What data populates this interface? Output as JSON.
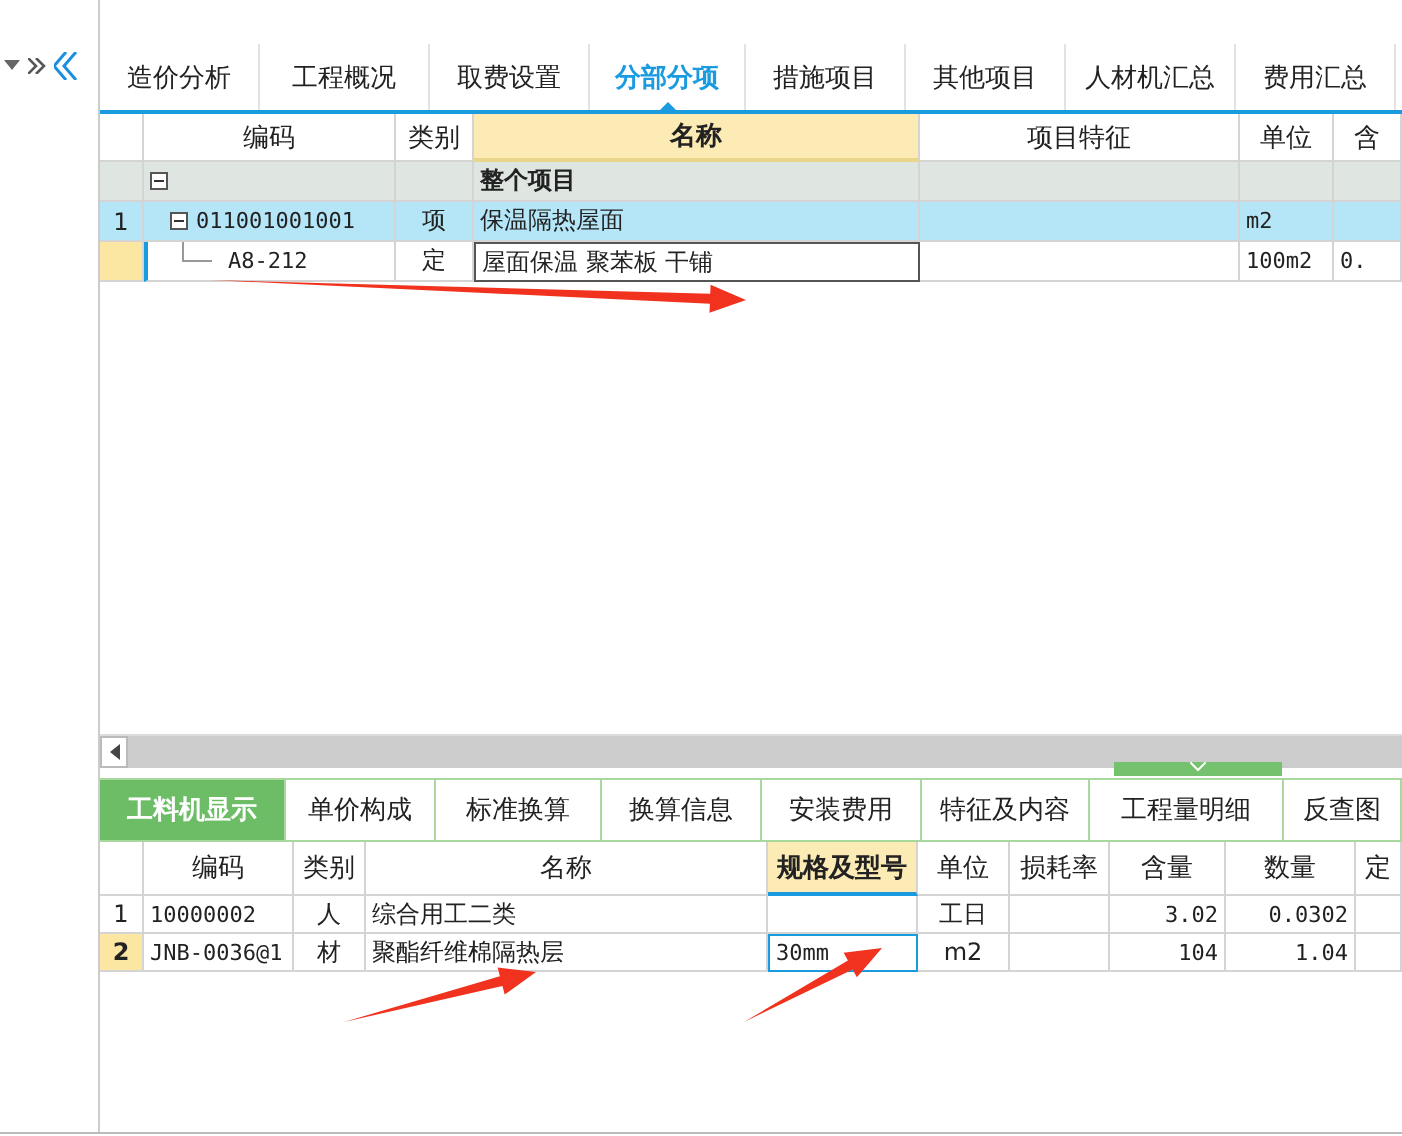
{
  "upper_tabs": [
    {
      "label": "造价分析",
      "selected": false
    },
    {
      "label": "工程概况",
      "selected": false
    },
    {
      "label": "取费设置",
      "selected": false
    },
    {
      "label": "分部分项",
      "selected": true
    },
    {
      "label": "措施项目",
      "selected": false
    },
    {
      "label": "其他项目",
      "selected": false
    },
    {
      "label": "人材机汇总",
      "selected": false
    },
    {
      "label": "费用汇总",
      "selected": false
    }
  ],
  "bill_table": {
    "columns": [
      {
        "active": false
      },
      {
        "label": "编码",
        "active": false
      },
      {
        "label": "类别",
        "active": false
      },
      {
        "label": "名称",
        "active": true
      },
      {
        "label": "项目特征",
        "active": false
      },
      {
        "label": "单位",
        "active": false
      },
      {
        "label": "含",
        "active": false
      }
    ],
    "rows": [
      {
        "kind": "group",
        "expanded": true,
        "selected": false,
        "editing": false,
        "cells": [
          "",
          "",
          "",
          "整个项目",
          "",
          "",
          ""
        ]
      },
      {
        "kind": "item",
        "expanded": true,
        "selected": true,
        "editing": false,
        "cells": [
          "1",
          "011001001001",
          "项",
          "保温隔热屋面",
          "",
          "m2",
          ""
        ]
      },
      {
        "kind": "quota",
        "selected": false,
        "editing": true,
        "cells": [
          "",
          "A8-212",
          "定",
          "屋面保温 聚苯板 干铺",
          "",
          "100m2",
          "0."
        ]
      }
    ]
  },
  "lower_tabs": [
    {
      "label": "工料机显示",
      "selected": true
    },
    {
      "label": "单价构成",
      "selected": false
    },
    {
      "label": "标准换算",
      "selected": false
    },
    {
      "label": "换算信息",
      "selected": false
    },
    {
      "label": "安装费用",
      "selected": false
    },
    {
      "label": "特征及内容",
      "selected": false
    },
    {
      "label": "工程量明细",
      "selected": false
    },
    {
      "label": "反查图",
      "selected": false
    }
  ],
  "resource_table": {
    "columns": [
      {
        "active": false
      },
      {
        "label": "编码",
        "active": false
      },
      {
        "label": "类别",
        "active": false
      },
      {
        "label": "名称",
        "active": false
      },
      {
        "label": "规格及型号",
        "active": true
      },
      {
        "label": "单位",
        "active": false
      },
      {
        "label": "损耗率",
        "active": false
      },
      {
        "label": "含量",
        "active": false
      },
      {
        "label": "数量",
        "active": false
      },
      {
        "label": "定",
        "active": false
      }
    ],
    "rows": [
      {
        "selected": false,
        "editing": false,
        "cells": [
          "1",
          "10000002",
          "人",
          "综合用工二类",
          "",
          "工日",
          "",
          "3.02",
          "0.0302",
          ""
        ]
      },
      {
        "selected": true,
        "editing": true,
        "cells": [
          "2",
          "JNB-0036@1",
          "材",
          "聚酯纤维棉隔热层",
          "30mm",
          "m2",
          "",
          "104",
          "1.04",
          ""
        ]
      }
    ]
  }
}
